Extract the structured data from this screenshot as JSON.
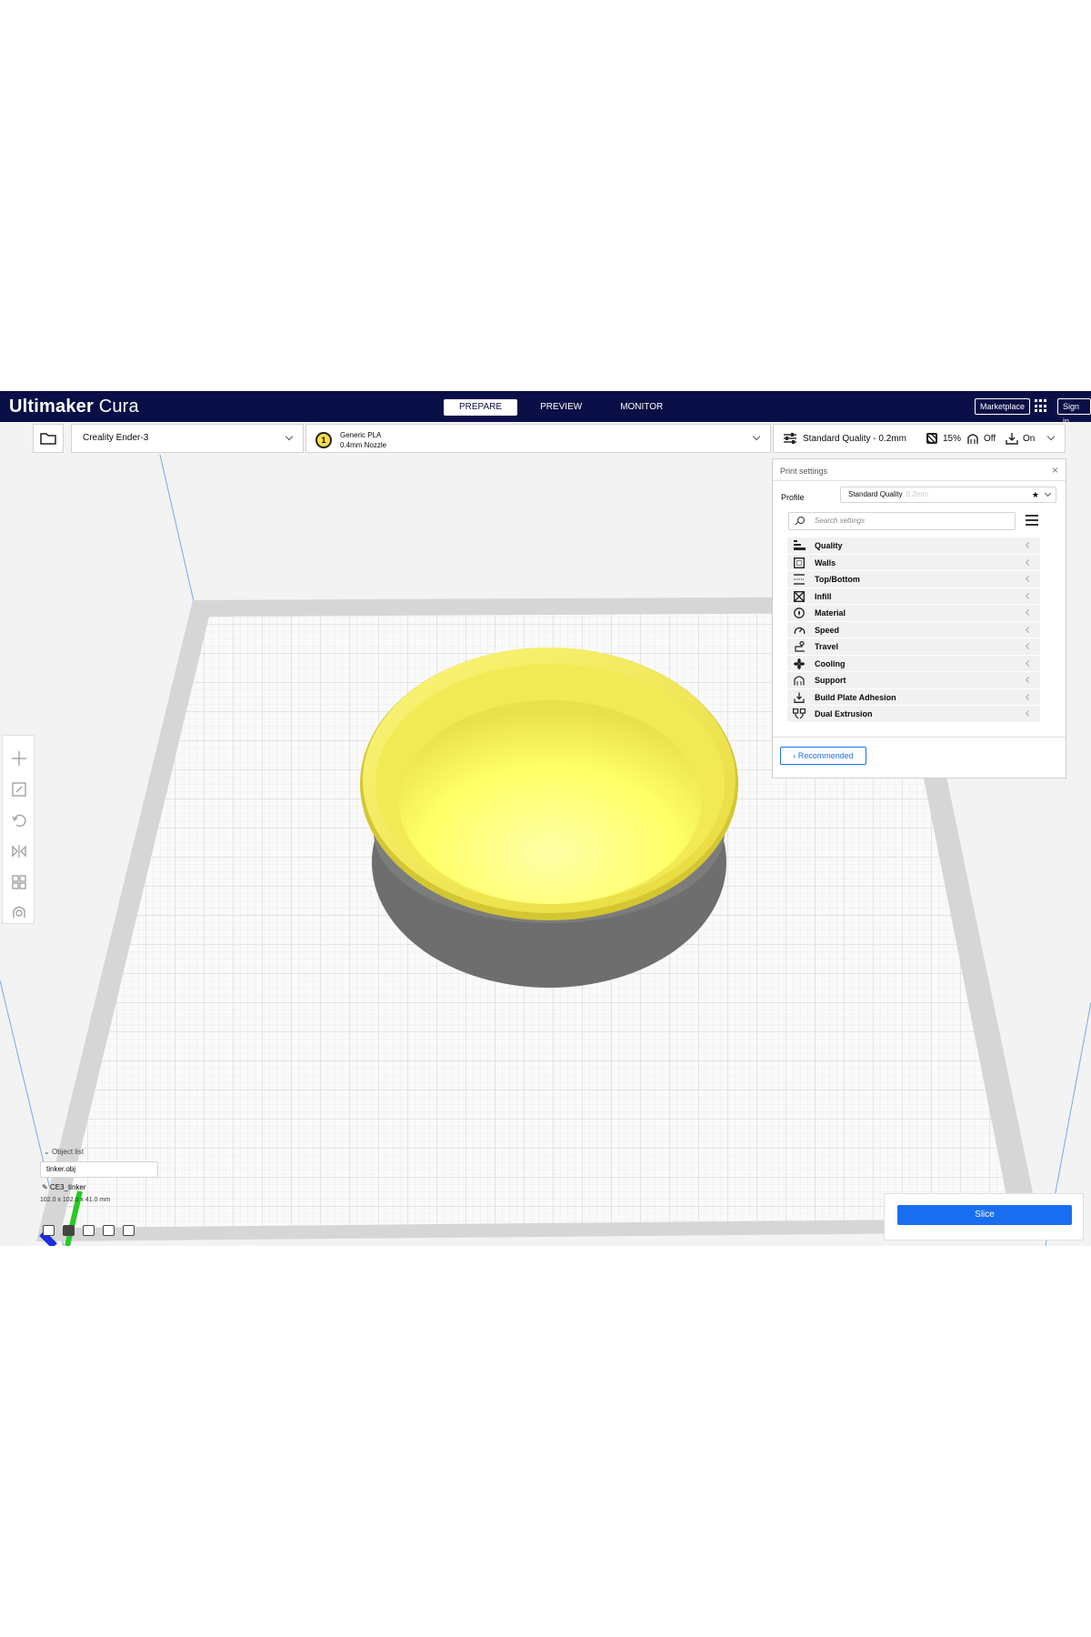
{
  "header": {
    "app_name_bold": "Ultimaker",
    "app_name_light": "Cura",
    "stages": [
      "PREPARE",
      "PREVIEW",
      "MONITOR"
    ],
    "active_stage": "PREPARE",
    "marketplace_label": "Marketplace",
    "signin_label": "Sign in"
  },
  "toolbar": {
    "printer": "Creality Ender-3",
    "extruder_number": "1",
    "material": "Generic PLA",
    "nozzle": "0.4mm Nozzle",
    "quality": "Standard Quality - 0.2mm",
    "infill": "15%",
    "support": "Off",
    "adhesion": "On"
  },
  "print_settings": {
    "title": "Print settings",
    "close": "×",
    "profile_label": "Profile",
    "profile_value": "Standard Quality",
    "profile_suffix": "0.2mm",
    "search_placeholder": "Search settings",
    "categories": [
      {
        "label": "Quality",
        "icon": "quality-icon"
      },
      {
        "label": "Walls",
        "icon": "walls-icon"
      },
      {
        "label": "Top/Bottom",
        "icon": "top-bottom-icon"
      },
      {
        "label": "Infill",
        "icon": "infill-icon"
      },
      {
        "label": "Material",
        "icon": "material-icon"
      },
      {
        "label": "Speed",
        "icon": "speed-icon"
      },
      {
        "label": "Travel",
        "icon": "travel-icon"
      },
      {
        "label": "Cooling",
        "icon": "cooling-icon"
      },
      {
        "label": "Support",
        "icon": "support-icon"
      },
      {
        "label": "Build Plate Adhesion",
        "icon": "build-plate-adhesion-icon"
      },
      {
        "label": "Dual Extrusion",
        "icon": "dual-extrusion-icon"
      }
    ],
    "recommended_label": "Recommended"
  },
  "object_list": {
    "header": "Object list",
    "file": "tinker.obj",
    "object_name": "CE3_tinker",
    "dimensions": "102.0 x 102.0 x 41.0 mm"
  },
  "slice": {
    "label": "Slice"
  },
  "colors": {
    "header_bg": "#0a0f47",
    "accent": "#196ef0",
    "model": "#ffff66"
  }
}
